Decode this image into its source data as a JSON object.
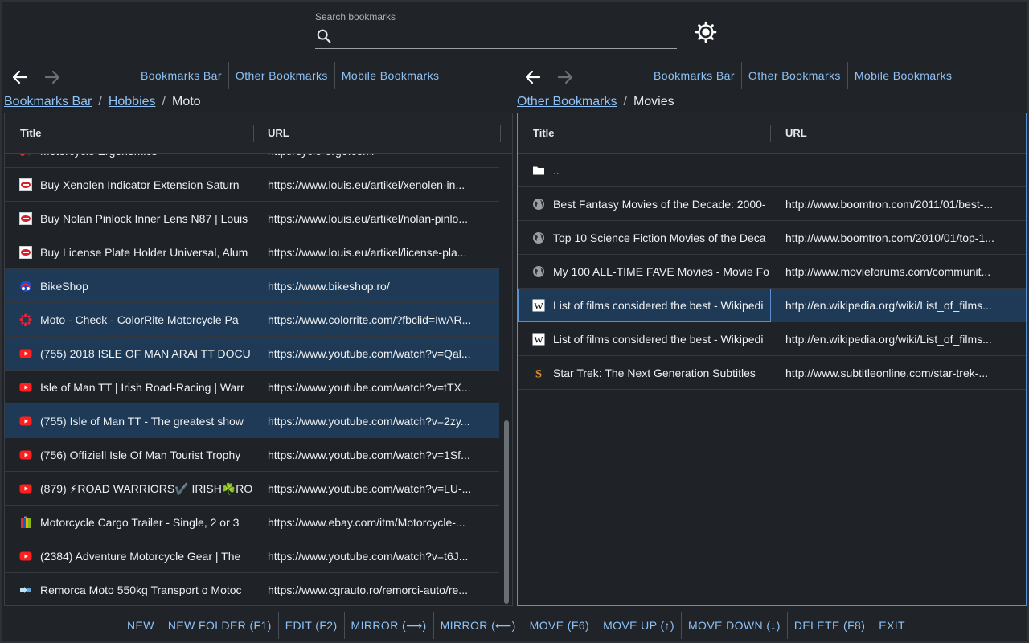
{
  "search": {
    "label": "Search bookmarks",
    "placeholder": "",
    "value": ""
  },
  "colors": {
    "accent": "#8ec2f7",
    "selected_row": "#1e3a56",
    "background": "#202327"
  },
  "left": {
    "tabs": [
      "Bookmarks Bar",
      "Other Bookmarks",
      "Mobile Bookmarks"
    ],
    "breadcrumb": {
      "links": [
        "Bookmarks Bar",
        "Hobbies"
      ],
      "current": "Moto"
    },
    "columns": {
      "title": "Title",
      "url": "URL"
    },
    "rows": [
      {
        "icon": "moto-ergo-icon",
        "title": "Motorcycle Ergonomics",
        "url": "http://cycle-ergo.com/",
        "selected": false
      },
      {
        "icon": "louis-icon",
        "title": "Buy Xenolen Indicator Extension Saturn",
        "url": "https://www.louis.eu/artikel/xenolen-in...",
        "selected": false
      },
      {
        "icon": "louis-icon",
        "title": "Buy Nolan Pinlock Inner Lens N87 | Louis",
        "url": "https://www.louis.eu/artikel/nolan-pinlo...",
        "selected": false
      },
      {
        "icon": "louis-icon",
        "title": "Buy License Plate Holder Universal, Alum",
        "url": "https://www.louis.eu/artikel/license-pla...",
        "selected": false
      },
      {
        "icon": "bikeshop-icon",
        "title": "BikeShop",
        "url": "https://www.bikeshop.ro/",
        "selected": true
      },
      {
        "icon": "colorrite-icon",
        "title": "Moto - Check - ColorRite Motorcycle Pa",
        "url": "https://www.colorrite.com/?fbclid=IwAR...",
        "selected": true
      },
      {
        "icon": "youtube-icon",
        "title": "(755) 2018 ISLE OF MAN ARAI TT DOCU",
        "url": "https://www.youtube.com/watch?v=Qal...",
        "selected": true
      },
      {
        "icon": "youtube-icon",
        "title": "Isle of Man TT | Irish Road-Racing | Warr",
        "url": "https://www.youtube.com/watch?v=tTX...",
        "selected": false
      },
      {
        "icon": "youtube-icon",
        "title": "(755) Isle of Man TT - The greatest show",
        "url": "https://www.youtube.com/watch?v=2zy...",
        "selected": true
      },
      {
        "icon": "youtube-icon",
        "title": "(756) Offiziell Isle Of Man Tourist Trophy",
        "url": "https://www.youtube.com/watch?v=1Sf...",
        "selected": false
      },
      {
        "icon": "youtube-icon",
        "title": "(879) ⚡ROAD WARRIORS✔️ IRISH☘️RO",
        "url": "https://www.youtube.com/watch?v=LU-...",
        "selected": false
      },
      {
        "icon": "ebay-icon",
        "title": "Motorcycle Cargo Trailer - Single, 2 or 3",
        "url": "https://www.ebay.com/itm/Motorcycle-...",
        "selected": false
      },
      {
        "icon": "youtube-icon",
        "title": "(2384) Adventure Motorcycle Gear | The",
        "url": "https://www.youtube.com/watch?v=t6J...",
        "selected": false
      },
      {
        "icon": "cgrauto-icon",
        "title": "Remorca Moto 550kg Transport o Motoc",
        "url": "https://www.cgrauto.ro/remorci-auto/re...",
        "selected": false
      }
    ]
  },
  "right": {
    "tabs": [
      "Bookmarks Bar",
      "Other Bookmarks",
      "Mobile Bookmarks"
    ],
    "breadcrumb": {
      "links": [
        "Other Bookmarks"
      ],
      "current": "Movies"
    },
    "columns": {
      "title": "Title",
      "url": "URL"
    },
    "rows": [
      {
        "icon": "folder-icon",
        "title": "..",
        "url": "",
        "selected": false
      },
      {
        "icon": "globe-icon",
        "title": "Best Fantasy Movies of the Decade: 2000-",
        "url": "http://www.boomtron.com/2011/01/best-...",
        "selected": false
      },
      {
        "icon": "globe-icon",
        "title": "Top 10 Science Fiction Movies of the Deca",
        "url": "http://www.boomtron.com/2010/01/top-1...",
        "selected": false
      },
      {
        "icon": "globe-icon",
        "title": "My 100 ALL-TIME FAVE Movies - Movie Fo",
        "url": "http://www.movieforums.com/communit...",
        "selected": false
      },
      {
        "icon": "wikipedia-icon",
        "title": "List of films considered the best - Wikipedi",
        "url": "http://en.wikipedia.org/wiki/List_of_films...",
        "selected": true
      },
      {
        "icon": "wikipedia-icon",
        "title": "List of films considered the best - Wikipedi",
        "url": "http://en.wikipedia.org/wiki/List_of_films...",
        "selected": false
      },
      {
        "icon": "subtitle-icon",
        "title": "Star Trek: The Next Generation Subtitles",
        "url": "http://www.subtitleonline.com/star-trek-...",
        "selected": false
      }
    ]
  },
  "footer": [
    "NEW",
    "NEW FOLDER (F1)",
    "EDIT (F2)",
    "MIRROR (⟶)",
    "MIRROR (⟵)",
    "MOVE (F6)",
    "MOVE UP (↑)",
    "MOVE DOWN (↓)",
    "DELETE (F8)",
    "EXIT"
  ]
}
